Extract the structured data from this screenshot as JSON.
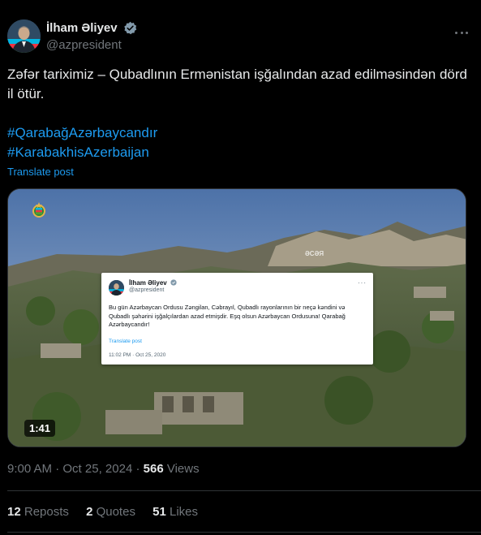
{
  "author": {
    "display_name": "İlham Əliyev",
    "handle": "@azpresident",
    "verified": true
  },
  "tweet": {
    "text": "Zəfər tariximiz – Qubadlının Ermənistan işğalından azad edilməsindən dörd il ötür.",
    "hashtags": [
      "#QarabağAzərbaycandır",
      "#KarabakhisAzerbaijan"
    ],
    "translate_label": "Translate post"
  },
  "media": {
    "duration": "1:41",
    "hillside_text": "ƏСƏЯ",
    "embedded_post": {
      "display_name": "İlham Əliyev",
      "handle": "@azpresident",
      "more": "···",
      "text": "Bu gün Azərbaycan Ordusu Zəngilan, Cəbrayıl, Qubadlı rayonlarının bir neçə kəndini və Qubadlı şəhərini işğalçılardan azad etmişdir. Eşq olsun Azərbaycan Ordusuna! Qarabağ Azərbaycandır!",
      "translate_label": "Translate post",
      "timestamp": "11:02 PM · Oct 25, 2020"
    }
  },
  "meta": {
    "time": "9:00 AM",
    "separator": "·",
    "date": "Oct 25, 2024",
    "views_count": "566",
    "views_label": "Views"
  },
  "stats": {
    "reposts_count": "12",
    "reposts_label": "Reposts",
    "quotes_count": "2",
    "quotes_label": "Quotes",
    "likes_count": "51",
    "likes_label": "Likes"
  },
  "colors": {
    "background": "#000000",
    "text": "#e7e9ea",
    "secondary": "#71767b",
    "link": "#1d9bf0",
    "verified": "#829aab",
    "divider": "#2f3336"
  },
  "icons": [
    "verified-badge-icon",
    "more-options-icon",
    "state-emblem-icon"
  ]
}
